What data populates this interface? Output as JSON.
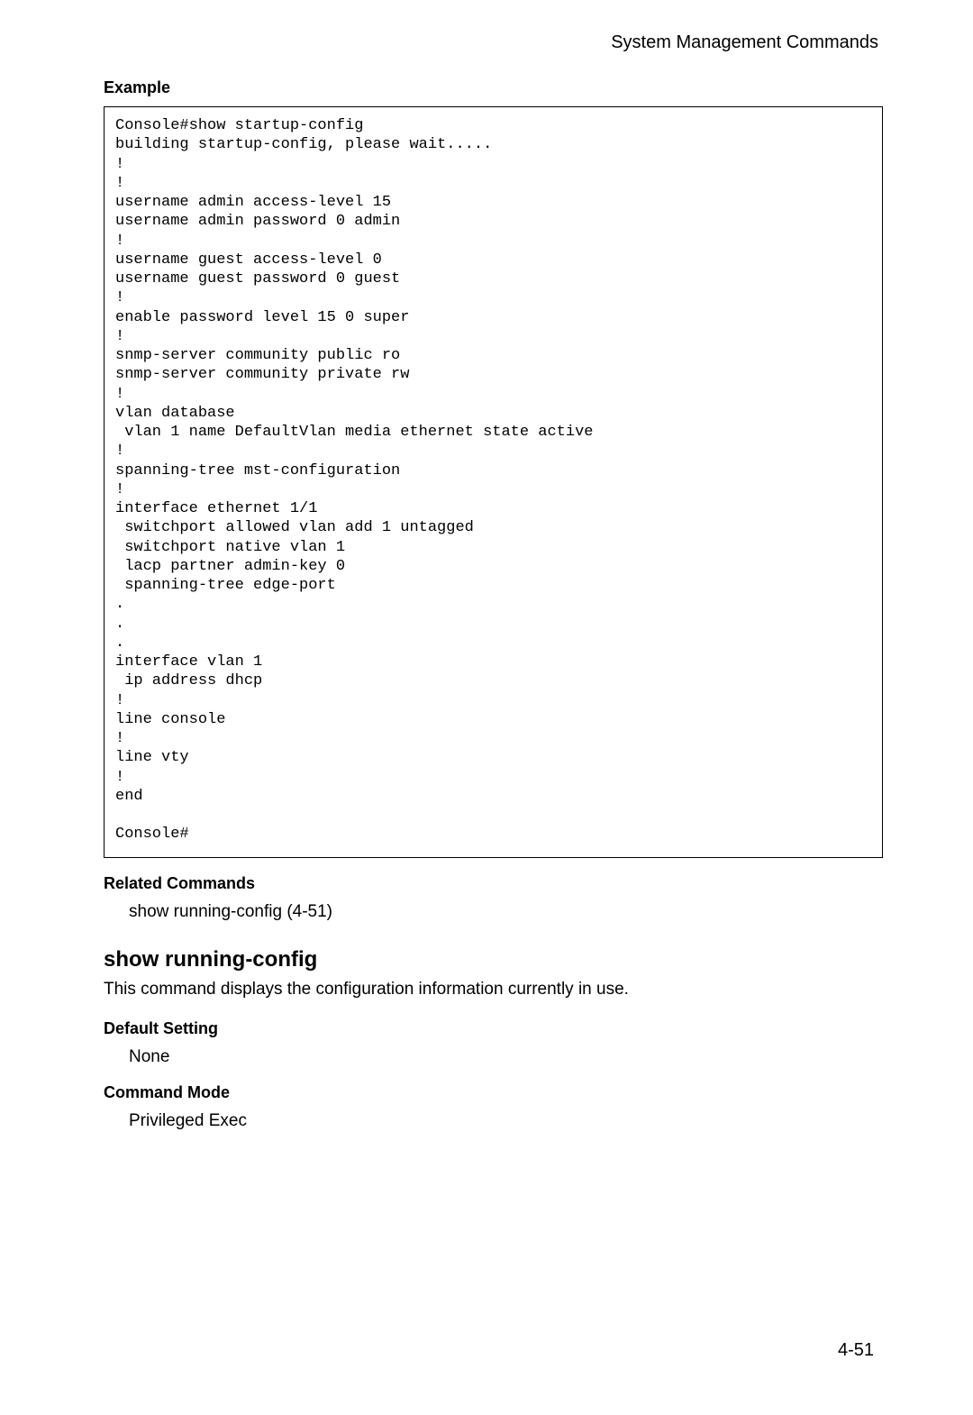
{
  "header": {
    "title": "System Management Commands"
  },
  "example": {
    "label": "Example",
    "code": "Console#show startup-config\nbuilding startup-config, please wait.....\n!\n!\nusername admin access-level 15\nusername admin password 0 admin\n!\nusername guest access-level 0\nusername guest password 0 guest\n!\nenable password level 15 0 super\n!\nsnmp-server community public ro\nsnmp-server community private rw\n!\nvlan database\n vlan 1 name DefaultVlan media ethernet state active\n!\nspanning-tree mst-configuration\n!\ninterface ethernet 1/1\n switchport allowed vlan add 1 untagged\n switchport native vlan 1\n lacp partner admin-key 0\n spanning-tree edge-port\n.\n.\n.\ninterface vlan 1\n ip address dhcp\n!\nline console\n!\nline vty\n!\nend\n\nConsole#"
  },
  "related": {
    "label": "Related Commands",
    "text": "show running-config (4-51)"
  },
  "command": {
    "heading": "show running-config",
    "description": "This command displays the configuration information currently in use."
  },
  "default_setting": {
    "label": "Default Setting",
    "value": "None"
  },
  "command_mode": {
    "label": "Command Mode",
    "value": "Privileged Exec"
  },
  "footer": {
    "page_number": "4-51"
  }
}
